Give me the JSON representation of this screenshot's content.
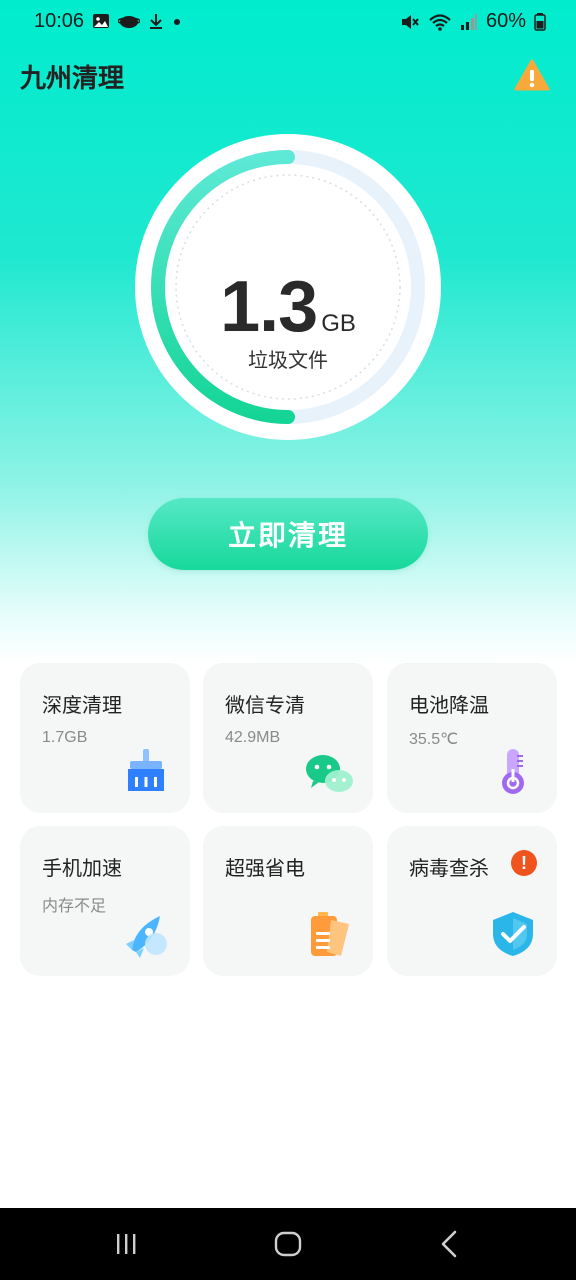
{
  "status_bar": {
    "time": "10:06",
    "battery": "60%",
    "icons_left": [
      "image-icon",
      "cloud-icon",
      "download-icon",
      "dot-icon"
    ],
    "icons_right": [
      "mute-icon",
      "wifi-icon",
      "signal-icon",
      "battery-icon"
    ]
  },
  "header": {
    "title": "九州清理",
    "warning_icon": "warning-icon",
    "warning_color": "#f7a93b"
  },
  "gauge": {
    "value": "1.3",
    "unit": "GB",
    "label": "垃圾文件",
    "fill_fraction": 0.5,
    "accent": "#19d899"
  },
  "clean_button": {
    "label": "立即清理"
  },
  "features": [
    {
      "title": "深度清理",
      "sub": "1.7GB",
      "icon": "broom-icon",
      "color": "#2f80ff"
    },
    {
      "title": "微信专清",
      "sub": "42.9MB",
      "icon": "wechat-icon",
      "color": "#19c98a"
    },
    {
      "title": "电池降温",
      "sub": "35.5℃",
      "icon": "thermometer-icon",
      "color": "#a06af0"
    },
    {
      "title": "手机加速",
      "sub": "内存不足",
      "icon": "rocket-icon",
      "color": "#4bb6ff"
    },
    {
      "title": "超强省电",
      "sub": "",
      "icon": "battery-save-icon",
      "color": "#ff9b3a"
    },
    {
      "title": "病毒查杀",
      "sub": "",
      "icon": "shield-check-icon",
      "color": "#2ab6e8",
      "badge": "!"
    }
  ],
  "nav": {
    "recent": "recent-apps-icon",
    "home": "home-icon",
    "back": "back-icon"
  }
}
